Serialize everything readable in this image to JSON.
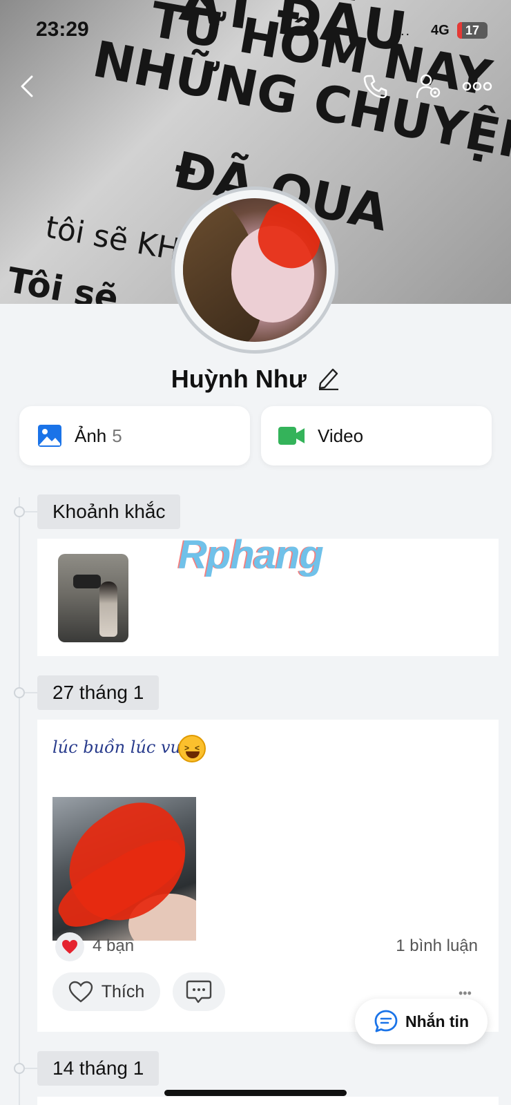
{
  "status_bar": {
    "time": "23:29",
    "signal": "..",
    "network": "4G",
    "battery": "17"
  },
  "cover": {
    "lines": [
      "ẮT ĐẦU",
      "TỪ HÔM NAY",
      "NHỮNG CHUYỆN",
      "ĐÃ QUA",
      "tôi sẽ KH",
      "Tôi sẽ"
    ]
  },
  "header": {
    "back_icon": "chevron-left-icon",
    "call_icon": "phone-icon",
    "settings_icon": "user-gear-icon",
    "more_icon": "ellipsis-icon"
  },
  "profile": {
    "name": "Huỳnh Như"
  },
  "media": {
    "photos": {
      "label": "Ảnh",
      "count": "5",
      "color": "#1a73e8"
    },
    "video": {
      "label": "Video",
      "color": "#34b35a"
    }
  },
  "watermark": "Rphang",
  "timeline": {
    "moments_label": "Khoảnh khắc",
    "section1_date": "27 tháng 1",
    "section2_date": "14 tháng 1"
  },
  "post": {
    "text": "lúc buồn lúc vui",
    "reactions": "4 bạn",
    "comments": "1 bình luận",
    "like_label": "Thích"
  },
  "fab": {
    "label": "Nhắn tin",
    "accent": "#1a73e8"
  }
}
